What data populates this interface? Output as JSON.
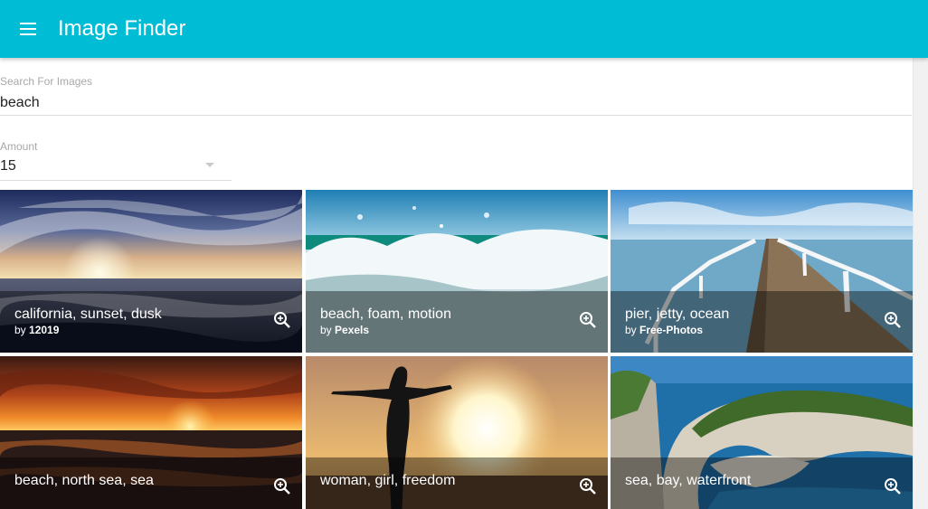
{
  "appbar": {
    "title": "Image Finder",
    "menu_icon": "menu-icon",
    "color": "#00bcd4"
  },
  "search": {
    "label": "Search For Images",
    "value": "beach"
  },
  "amount": {
    "label": "Amount",
    "value": "15"
  },
  "images": [
    {
      "tags": "california, sunset, dusk",
      "by": "by",
      "user": "12019"
    },
    {
      "tags": "beach, foam, motion",
      "by": "by",
      "user": "Pexels"
    },
    {
      "tags": "pier, jetty, ocean",
      "by": "by",
      "user": "Free-Photos"
    },
    {
      "tags": "beach, north sea, sea",
      "by": "",
      "user": ""
    },
    {
      "tags": "woman, girl, freedom",
      "by": "",
      "user": ""
    },
    {
      "tags": "sea, bay, waterfront",
      "by": "",
      "user": ""
    }
  ],
  "zoom_icon": "zoom-in-icon"
}
